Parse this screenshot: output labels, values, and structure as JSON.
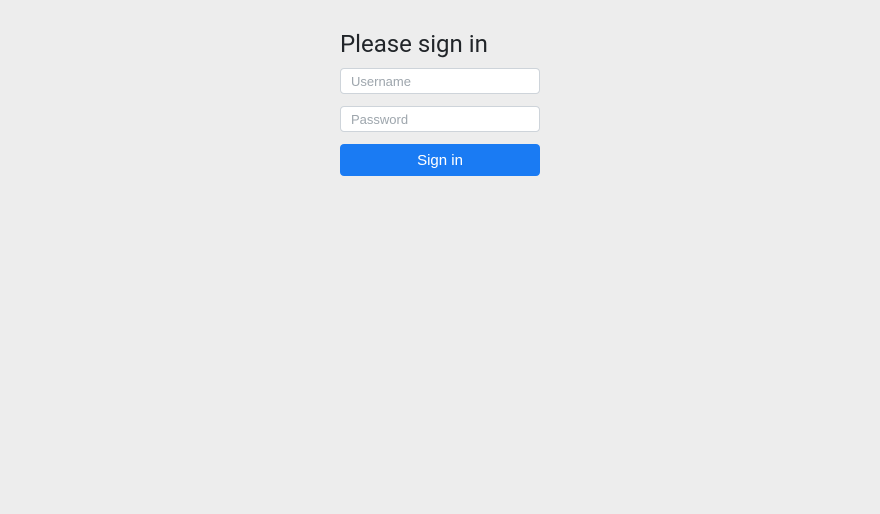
{
  "login": {
    "heading": "Please sign in",
    "username_placeholder": "Username",
    "password_placeholder": "Password",
    "button_label": "Sign in"
  }
}
